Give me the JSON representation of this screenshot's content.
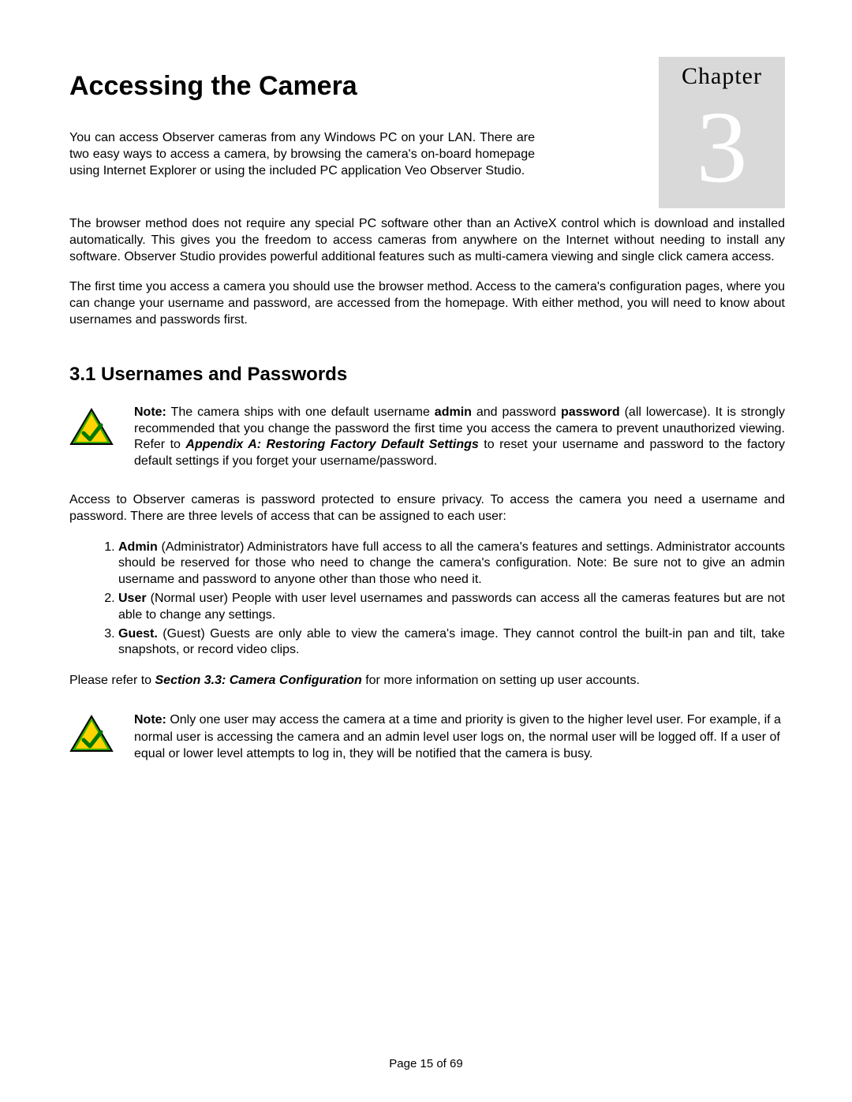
{
  "chapter": {
    "word": "Chapter",
    "number": "3"
  },
  "title": "Accessing the Camera",
  "intro": {
    "p1a": "You can access Observer cameras from any Windows PC on your LAN. There are two easy ways to access a camera, by browsing the camera's on-board homepage using Internet Explorer or using the included PC application Veo Observer Studio.",
    "p2": "The browser method does not require any special PC software other than an ActiveX control which is download and installed automatically. This gives you the freedom to access cameras from anywhere on the Internet without needing to install any software. Observer Studio provides powerful additional features such as multi-camera viewing and single click camera access.",
    "p3": "The first time you access a camera you should use the browser method. Access to the camera's configuration pages, where you can change your username and password, are accessed from the homepage. With either method, you will need to know about usernames and passwords first."
  },
  "section31": {
    "heading": "3.1 Usernames and Passwords",
    "note1": {
      "label": "Note:",
      "t1": " The camera ships with one default username ",
      "b1": "admin",
      "t2": " and password ",
      "b2": "password",
      "t3": " (all lowercase). It is strongly recommended that you change the password the first time you access the camera to prevent unauthorized viewing. Refer to ",
      "ref": "Appendix A: Restoring Factory Default Settings",
      "t4": " to reset your username and password to the factory default settings if you forget your username/password."
    },
    "para": "Access to Observer cameras is password protected to ensure privacy. To access the camera you need a username and password. There are three levels of access that can be assigned to each user:",
    "list": {
      "i1": {
        "b": "Admin",
        "t": " (Administrator) Administrators have full access to all the camera's features and settings. Administrator accounts should be reserved for those who need to change the camera's configuration. Note: Be sure not to give an admin username and password to anyone other than those who need it."
      },
      "i2": {
        "b": "User",
        "t": " (Normal user) People with user level usernames and passwords can access all the cameras features but are not able to change any settings."
      },
      "i3": {
        "b": "Guest.",
        "t": " (Guest) Guests are only able to view the camera's image. They cannot control the built-in pan and tilt, take snapshots, or record video clips."
      }
    },
    "refer": {
      "t1": "Please refer to ",
      "ref": "Section 3.3: Camera Configuration",
      "t2": " for more information on setting up user accounts."
    },
    "note2": {
      "label": "Note:",
      "t": " Only one user may access the camera at a time and priority is given to the higher level user. For example, if a normal user is accessing the camera and an admin level user logs on, the normal user will be logged off. If a user of equal or lower level attempts to log in, they will be notified that the camera is busy."
    }
  },
  "footer": "Page 15 of 69"
}
